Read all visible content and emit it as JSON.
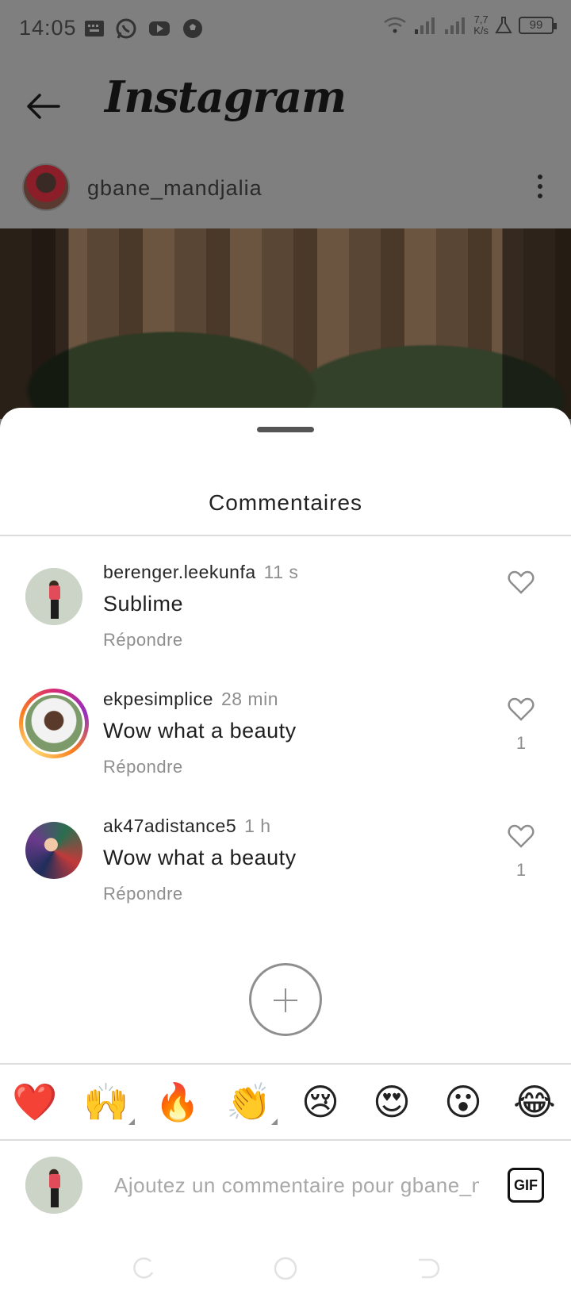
{
  "status_bar": {
    "time": "14:05",
    "speed_value": "7,7",
    "speed_unit": "K/s",
    "battery": "99"
  },
  "app_bar": {
    "title": "Instagram"
  },
  "post": {
    "username": "gbane_mandjalia"
  },
  "sheet": {
    "title": "Commentaires"
  },
  "comments": [
    {
      "user": "berenger.leekunfa",
      "time": "11 s",
      "text": "Sublime",
      "reply": "Répondre",
      "likes": ""
    },
    {
      "user": "ekpesimplice",
      "time": "28 min",
      "text": "Wow what a beauty",
      "reply": "Répondre",
      "likes": "1"
    },
    {
      "user": "ak47adistance5",
      "time": "1 h",
      "text": "Wow what a beauty",
      "reply": "Répondre",
      "likes": "1"
    }
  ],
  "emojis": [
    "❤️",
    "🙌",
    "🔥",
    "👏",
    "😢",
    "😍",
    "😮",
    "😂"
  ],
  "compose": {
    "placeholder": "Ajoutez un commentaire pour gbane_mandjalia...",
    "gif_label": "GIF"
  },
  "colors": {
    "dim_overlay": "#7f7f7f",
    "sheet_bg": "#ffffff",
    "muted_text": "#8e8e8e",
    "story_ring": [
      "#d62976",
      "#962fbf",
      "#fa7e1e",
      "#feda75"
    ]
  }
}
